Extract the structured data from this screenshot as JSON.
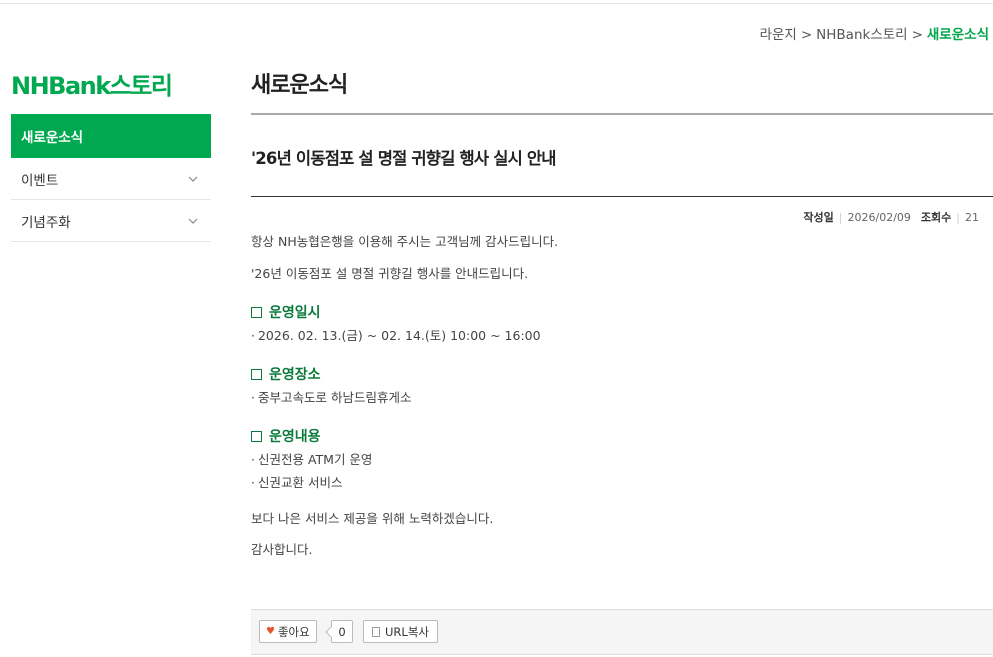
{
  "breadcrumb": {
    "items": [
      "라운지",
      "NHBank스토리"
    ],
    "current": "새로운소식",
    "separator": ">"
  },
  "sidebar": {
    "brand": "NHBank스토리",
    "items": [
      {
        "label": "새로운소식",
        "active": true
      },
      {
        "label": "이벤트",
        "icon": "chevron-down-icon"
      },
      {
        "label": "기념주화",
        "icon": "chevron-down-icon"
      }
    ]
  },
  "page": {
    "title": "새로운소식"
  },
  "post": {
    "title": "'26년 이동점포 설 명절 귀향길 행사 실시 안내",
    "meta": {
      "date_label": "작성일",
      "date": "2026/02/09",
      "views_label": "조회수",
      "views": "21"
    },
    "greeting": "항상 NH농협은행을 이용해 주시는 고객님께 감사드립니다.",
    "intro": "'26년 이동점포 설 명절 귀향길 행사를 안내드립니다.",
    "sections": [
      {
        "heading": "운영일시",
        "bullets": [
          "2026. 02. 13.(금) ~ 02. 14.(토) 10:00 ~ 16:00"
        ]
      },
      {
        "heading": "운영장소",
        "bullets": [
          "중부고속도로 하남드림휴게소"
        ]
      },
      {
        "heading": "운영내용",
        "bullets": [
          "신권전용 ATM기 운영",
          "신권교환 서비스"
        ]
      }
    ],
    "closing1": "보다 나은 서비스 제공을 위해 노력하겠습니다.",
    "closing2": "감사합니다."
  },
  "actions": {
    "like_label": "좋아요",
    "like_count": "0",
    "url_copy_label": "URL복사"
  },
  "colors": {
    "brand_green": "#00a84f",
    "section_green": "#0b7a3a",
    "breadcrumb_current": "#03a64a",
    "heart": "#e2552f"
  }
}
